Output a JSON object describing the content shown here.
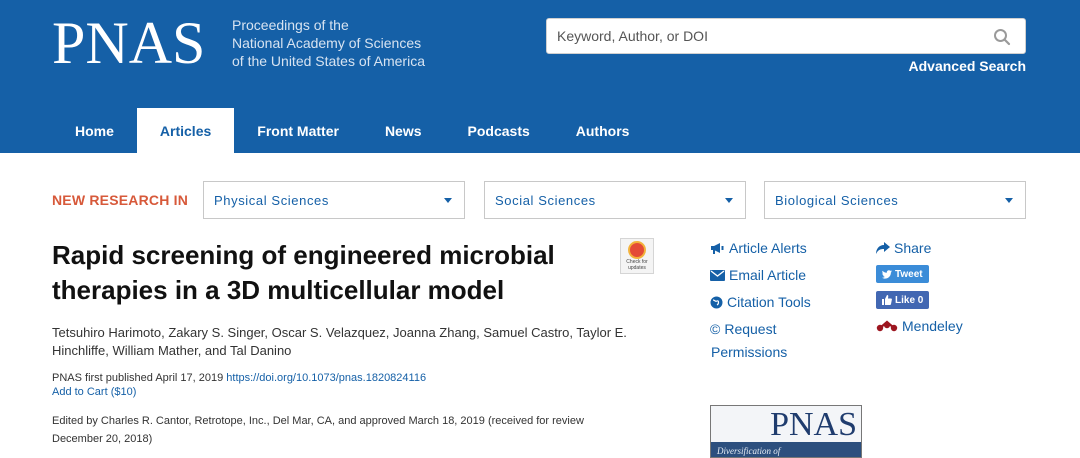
{
  "header": {
    "logo": "PNAS",
    "tagline": [
      "Proceedings of the",
      "National Academy of Sciences",
      "of the United States of America"
    ],
    "search_placeholder": "Keyword, Author, or DOI",
    "advanced_search": "Advanced Search"
  },
  "nav": {
    "tabs": [
      {
        "label": "Home",
        "active": false
      },
      {
        "label": "Articles",
        "active": true
      },
      {
        "label": "Front Matter",
        "active": false
      },
      {
        "label": "News",
        "active": false
      },
      {
        "label": "Podcasts",
        "active": false
      },
      {
        "label": "Authors",
        "active": false
      }
    ]
  },
  "research": {
    "label": "NEW RESEARCH IN",
    "dropdowns": [
      "Physical Sciences",
      "Social Sciences",
      "Biological Sciences"
    ]
  },
  "article": {
    "title": "Rapid screening of engineered microbial therapies in a 3D multicellular model",
    "crossmark": "Check for updates",
    "authors": "Tetsuhiro Harimoto, Zakary S. Singer, Oscar S. Velazquez, Joanna Zhang, Samuel Castro, Taylor E. Hinchliffe, William Mather, and Tal Danino",
    "published": "PNAS first published April 17, 2019",
    "doi": "https://doi.org/10.1073/pnas.1820824116",
    "cart": "Add to Cart ($10)",
    "edited": "Edited by Charles R. Cantor, Retrotope, Inc., Del Mar, CA, and approved March 18, 2019 (received for review December 20, 2018)"
  },
  "tools": {
    "article_alerts": "Article Alerts",
    "email_article": "Email Article",
    "citation_tools": "Citation Tools",
    "request_permissions_1": "Request",
    "request_permissions_2": "Permissions",
    "share": "Share",
    "tweet": "Tweet",
    "like": "Like 0",
    "mendeley": "Mendeley"
  },
  "cover": {
    "logo": "PNAS",
    "band_text": "Diversification of"
  },
  "colors": {
    "header_bg": "#1560a7",
    "accent_red": "#d7593a",
    "link_blue": "#1560a7"
  }
}
